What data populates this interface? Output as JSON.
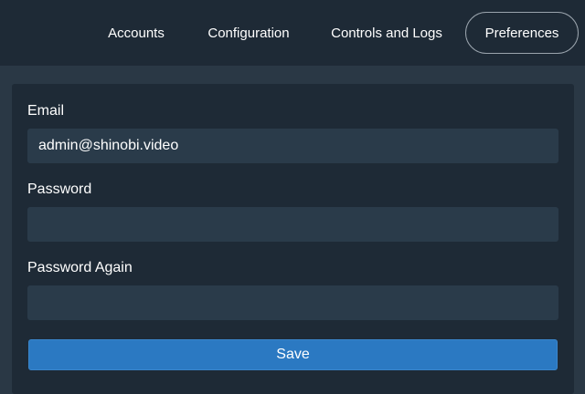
{
  "nav": {
    "tabs": [
      {
        "label": "Accounts"
      },
      {
        "label": "Configuration"
      },
      {
        "label": "Controls and Logs"
      },
      {
        "label": "Preferences",
        "active": true
      }
    ]
  },
  "form": {
    "email": {
      "label": "Email",
      "value": "admin@shinobi.video"
    },
    "password": {
      "label": "Password",
      "value": ""
    },
    "password_again": {
      "label": "Password Again",
      "value": ""
    },
    "save_label": "Save"
  },
  "colors": {
    "background": "#2a3845",
    "panel": "#1e2a36",
    "input": "#2a3b4a",
    "accent": "#2b79c2"
  }
}
